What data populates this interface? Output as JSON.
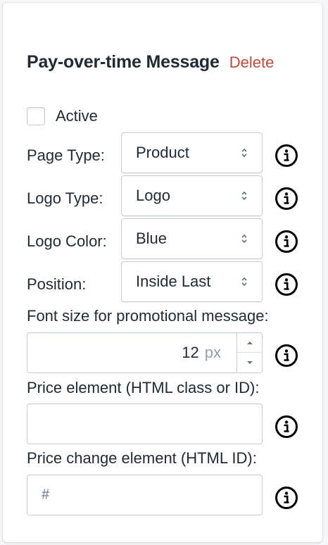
{
  "header": {
    "title": "Pay-over-time Message",
    "delete_label": "Delete"
  },
  "active": {
    "label": "Active",
    "checked": false
  },
  "fields": [
    {
      "label": "Page Type:",
      "value": "Product"
    },
    {
      "label": "Logo Type:",
      "value": "Logo"
    },
    {
      "label": "Logo Color:",
      "value": "Blue"
    },
    {
      "label": "Position:",
      "value": "Inside Last"
    }
  ],
  "font_size": {
    "label": "Font size for promotional message:",
    "value": "12",
    "suffix": "px"
  },
  "price_element": {
    "label": "Price element (HTML class or ID):",
    "value": ""
  },
  "price_change": {
    "label": "Price change element (HTML ID):",
    "value": "#"
  },
  "colors": {
    "delete": "#bf4a36",
    "border": "#c4cdd5",
    "text": "#212b36"
  }
}
